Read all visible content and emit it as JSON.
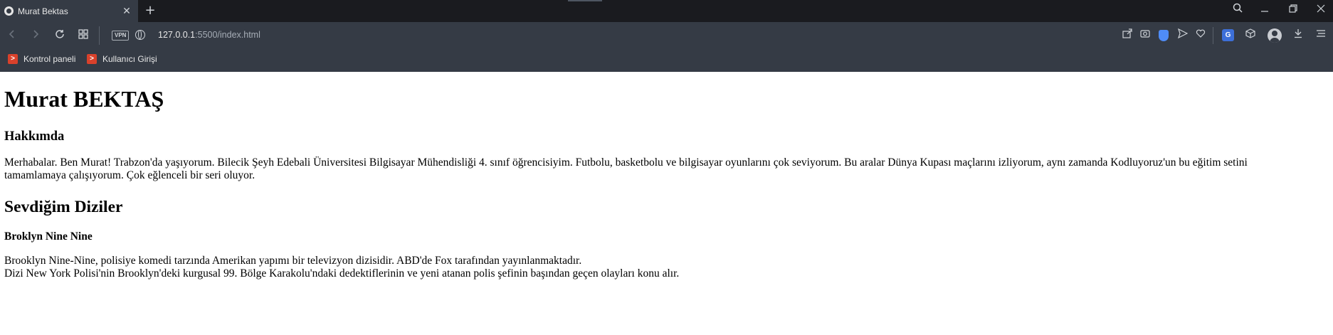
{
  "browser": {
    "tab_title": "Murat Bektas",
    "tab_close": "✕",
    "new_tab": "+",
    "vpn_label": "VPN",
    "url_host": "127.0.0.1",
    "url_rest": ":5500/index.html",
    "bookmarks": [
      {
        "label": "Kontrol paneli",
        "icon": "bookmark-favicon-icon"
      },
      {
        "label": "Kullanıcı Girişi",
        "icon": "bookmark-favicon-icon"
      }
    ],
    "colors": {
      "tabbar": "#1a1b1f",
      "toolbar": "#353b45",
      "shield": "#4f8cf7",
      "bookmark_favicon": "#d9412b"
    }
  },
  "page": {
    "title": "Murat BEKTAŞ",
    "about_heading": "Hakkımda",
    "about_text": "Merhabalar. Ben Murat! Trabzon'da yaşıyorum. Bilecik Şeyh Edebali Üniversitesi Bilgisayar Mühendisliği 4. sınıf öğrencisiyim. Futbolu, basketbolu ve bilgisayar oyunlarını çok seviyorum. Bu aralar Dünya Kupası maçlarını izliyorum, aynı zamanda Kodluyoruz'un bu eğitim setini tamamlamaya çalışıyorum. Çok eğlenceli bir seri oluyor.",
    "series_heading": "Sevdiğim Diziler",
    "show_title": "Broklyn Nine Nine",
    "show_line1": "Brooklyn Nine-Nine, polisiye komedi tarzında Amerikan yapımı bir televizyon dizisidir. ABD'de Fox tarafından yayınlanmaktadır.",
    "show_line2": "Dizi New York Polisi'nin Brooklyn'deki kurgusal 99. Bölge Karakolu'ndaki dedektiflerinin ve yeni atanan polis şefinin başından geçen olayları konu alır."
  }
}
